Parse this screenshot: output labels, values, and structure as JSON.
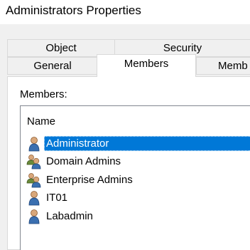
{
  "window": {
    "title": "Administrators Properties"
  },
  "tabs": {
    "back_row": [
      "Object",
      "Security"
    ],
    "front_row": [
      "General",
      "Members",
      "Memb"
    ],
    "selected": "Members"
  },
  "members": {
    "label": "Members:",
    "column_header": "Name",
    "items": [
      {
        "name": "Administrator",
        "icon": "user-icon",
        "selected": true
      },
      {
        "name": "Domain Admins",
        "icon": "group-icon",
        "selected": false
      },
      {
        "name": "Enterprise Admins",
        "icon": "group-icon",
        "selected": false
      },
      {
        "name": "IT01",
        "icon": "user-icon",
        "selected": false
      },
      {
        "name": "Labadmin",
        "icon": "user-icon",
        "selected": false
      }
    ]
  },
  "colors": {
    "selection": "#0078d7",
    "dialog_bg": "#f0f0f0"
  }
}
